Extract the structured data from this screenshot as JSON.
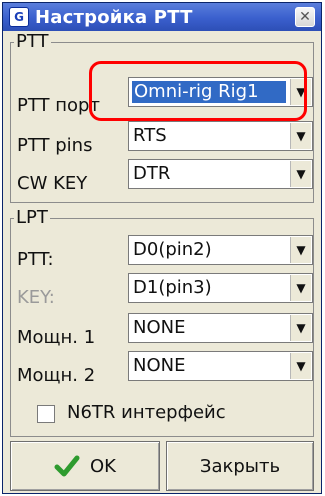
{
  "window": {
    "title": "Настройка PTT",
    "app_icon_glyph": "G"
  },
  "ptt_group": {
    "legend": "PTT",
    "rows": [
      {
        "label": "PTT порт",
        "value": "Omni-rig Rig1"
      },
      {
        "label": "PTT pins",
        "value": "RTS"
      },
      {
        "label": "CW KEY",
        "value": "DTR"
      }
    ]
  },
  "lpt_group": {
    "legend": "LPT",
    "rows": [
      {
        "label": "PTT:",
        "value": "D0(pin2)"
      },
      {
        "label": "KEY:",
        "value": "D1(pin3)"
      },
      {
        "label": "Мощн. 1",
        "value": "NONE"
      },
      {
        "label": "Мощн. 2",
        "value": "NONE"
      }
    ]
  },
  "n6tr_checkbox": {
    "label": "N6TR интерфейс",
    "checked": false
  },
  "buttons": {
    "ok": "OK",
    "close": "Закрыть"
  },
  "colors": {
    "titlebar": "#3a5fcd",
    "selection": "#316ac5",
    "highlight": "#ff0000",
    "check": "#2e9b2e"
  },
  "icons": {
    "close": "close-icon",
    "ok": "check-icon",
    "dropdown": "chevron-down-icon"
  }
}
